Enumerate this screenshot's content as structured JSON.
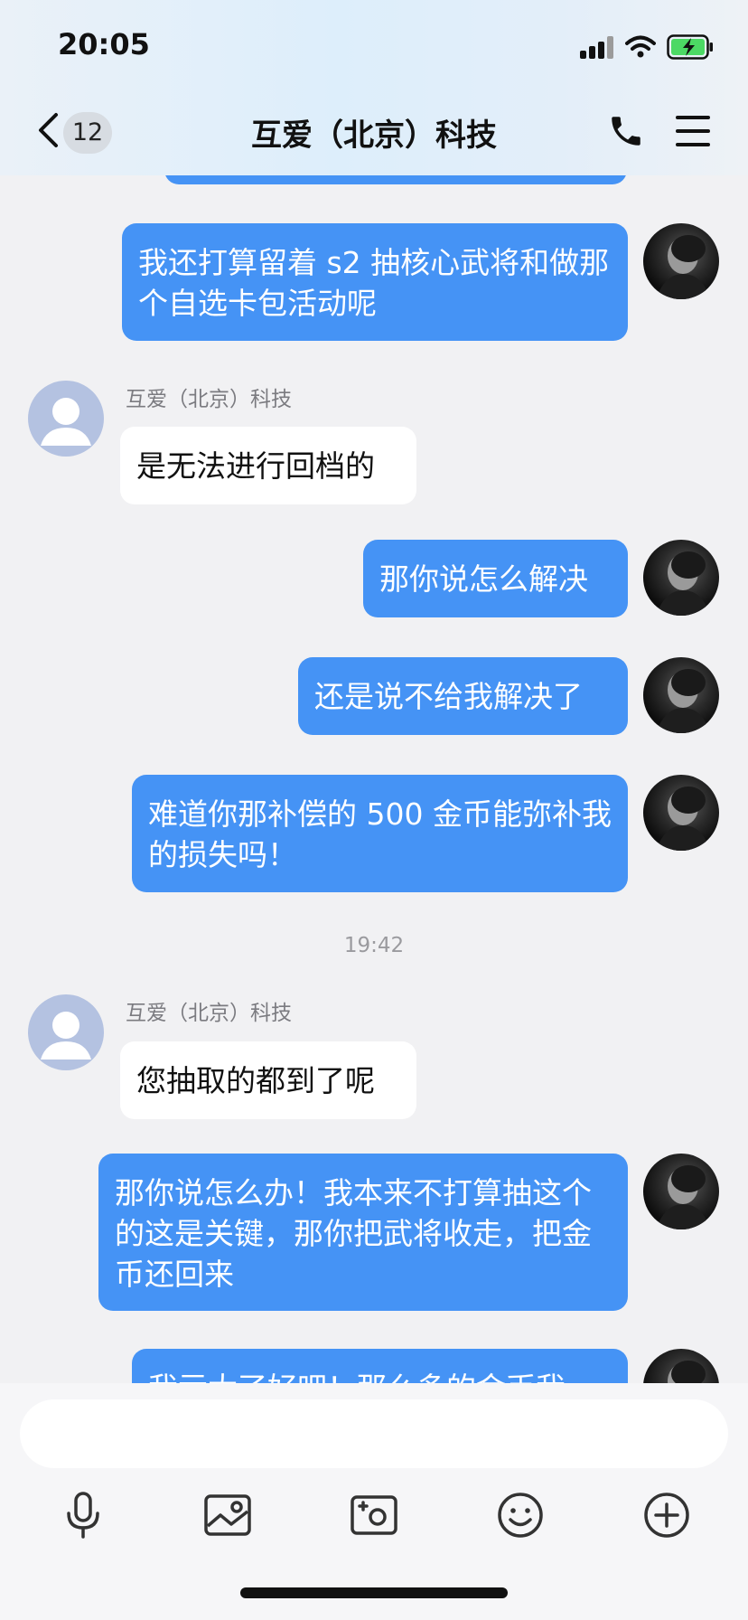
{
  "status": {
    "time": "20:05"
  },
  "nav": {
    "unread_count": "12",
    "title": "互爱（北京）科技"
  },
  "messages": [
    {
      "text": "我还打算留着 s2 抽核心武将和做那个自选卡包活动呢"
    },
    {
      "sender": "互爱（北京）科技",
      "text": "是无法进行回档的"
    },
    {
      "text": "那你说怎么解决"
    },
    {
      "text": "还是说不给我解决了"
    },
    {
      "text": "难道你那补偿的 500 金币能弥补我的损失吗！"
    },
    {
      "timestamp": "19:42"
    },
    {
      "sender": "互爱（北京）科技",
      "text": "您抽取的都到了呢"
    },
    {
      "text": "那你说怎么办！我本来不打算抽这个的这是关键，那你把武将收走，把金币还回来"
    },
    {
      "text": "我亏大了好吧！那么多的金币我"
    }
  ],
  "input": {
    "value": ""
  },
  "colors": {
    "my_bubble": "#4593f5",
    "their_bubble": "#ffffff",
    "accent_battery": "#4cd964"
  },
  "icons": {
    "toolbar": [
      "microphone-icon",
      "image-icon",
      "camera-icon",
      "emoji-icon",
      "plus-icon"
    ]
  }
}
